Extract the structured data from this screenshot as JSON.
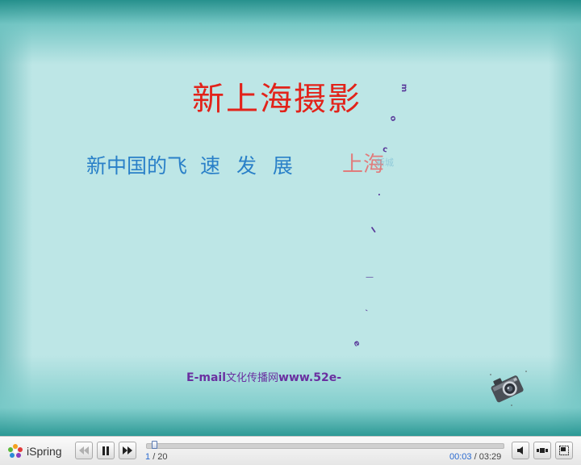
{
  "slide": {
    "title": "新上海摄影",
    "subtitle_words": [
      "新中国的飞",
      "速",
      "发",
      "展"
    ],
    "shanghai_text": "上海",
    "faint_text": "新城",
    "scatter_chars": [
      "m",
      "o",
      "c",
      ".",
      "l",
      "—",
      "-",
      "e"
    ],
    "email_prefix": "E-mail",
    "email_cn": "文化传播网",
    "email_suffix": "www.52e-"
  },
  "player": {
    "brand": "iSpring",
    "slide_current": "1",
    "slide_total": "/ 20",
    "time_current": "00:03",
    "time_total": "/ 03:29",
    "progress_fraction": 0.015
  },
  "colors": {
    "title": "#e2231a",
    "subtitle": "#2a80c8",
    "email": "#6a2fa0",
    "slide_bg": "#bde6e6"
  }
}
